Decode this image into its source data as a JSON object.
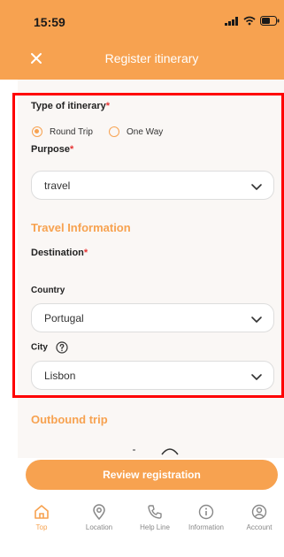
{
  "status": {
    "time": "15:59"
  },
  "header": {
    "title": "Register itinerary"
  },
  "form": {
    "type_label": "Type of itinerary",
    "required_mark": "*",
    "options": [
      {
        "label": "Round Trip",
        "selected": true
      },
      {
        "label": "One Way",
        "selected": false
      }
    ],
    "purpose_label": "Purpose",
    "purpose_value": "travel",
    "travel_info_title": "Travel Information",
    "destination_label": "Destination",
    "country_label": "Country",
    "country_value": "Portugal",
    "city_label": "City",
    "city_value": "Lisbon",
    "outbound_title": "Outbound trip"
  },
  "actions": {
    "review_label": "Review registration"
  },
  "nav": [
    {
      "label": "Top",
      "icon": "home-icon",
      "active": true
    },
    {
      "label": "Location",
      "icon": "location-pin-icon",
      "active": false
    },
    {
      "label": "Help Line",
      "icon": "phone-icon",
      "active": false
    },
    {
      "label": "Information",
      "icon": "info-icon",
      "active": false
    },
    {
      "label": "Account",
      "icon": "account-icon",
      "active": false
    }
  ],
  "colors": {
    "accent": "#F7A250",
    "required": "#e63333",
    "highlight": "#ff0000"
  }
}
